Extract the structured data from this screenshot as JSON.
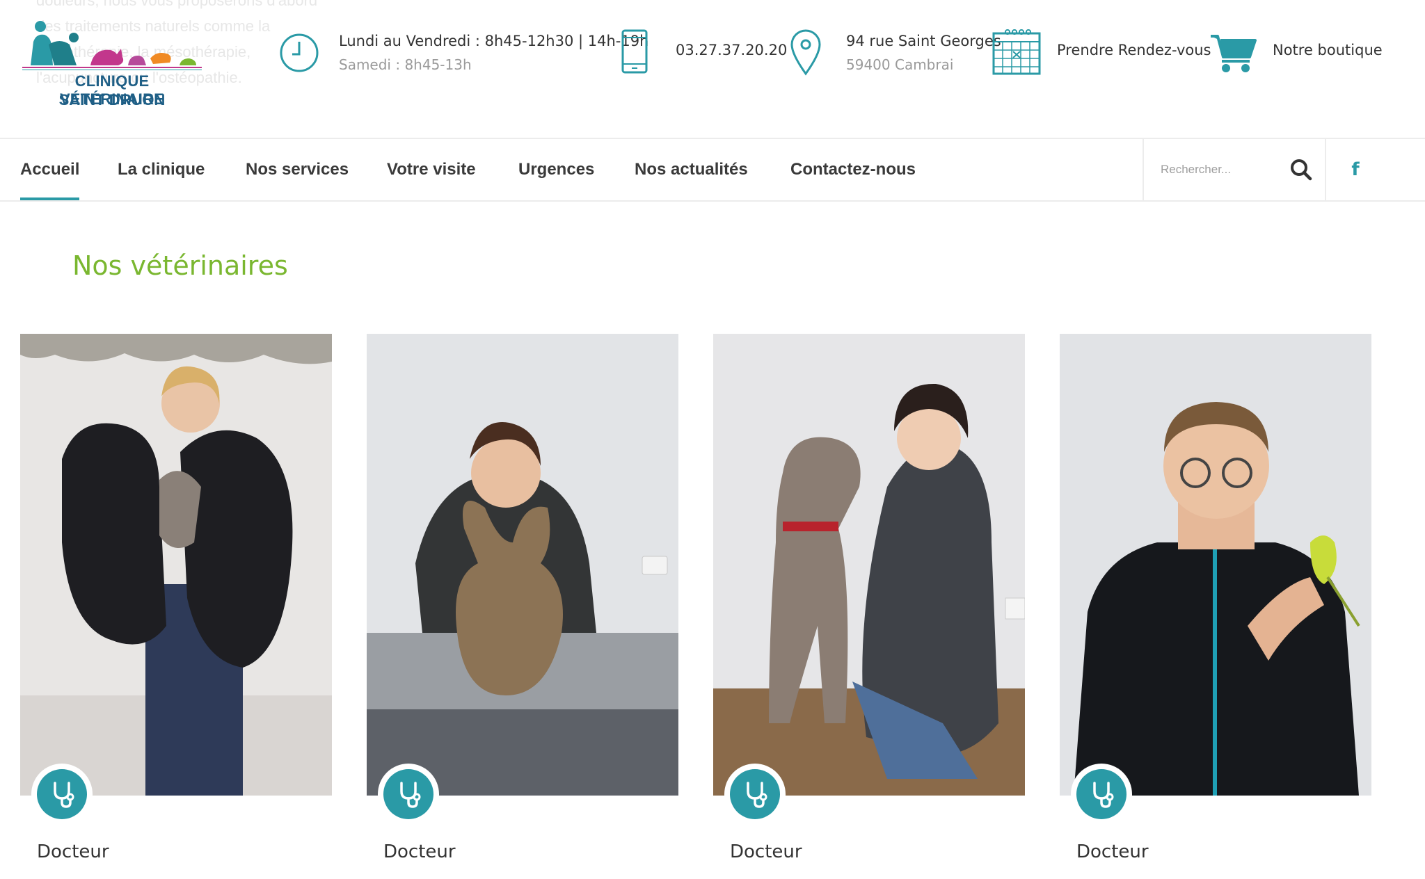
{
  "background_text": [
    "douleurs, nous vous proposerons d'abord",
    "des traitements naturels comme la",
    "phytothérapie, la mésothérapie,",
    "l'acupuncture ou l'ostéopathie."
  ],
  "logo": {
    "line1": "CLINIQUE VÉTÉRINAIRE",
    "line2": "SAINT DRUON"
  },
  "header": {
    "hours": {
      "line1": "Lundi au Vendredi : 8h45-12h30 | 14h-19h",
      "line2": "Samedi : 8h45-13h",
      "icon": "clock-icon"
    },
    "phone": {
      "number": "03.27.37.20.20",
      "icon": "mobile-phone-icon"
    },
    "address": {
      "line1": "94 rue Saint Georges",
      "line2": "59400 Cambrai",
      "icon": "map-pin-icon"
    },
    "appointment": {
      "label": "Prendre Rendez-vous",
      "icon": "calendar-icon"
    },
    "shop": {
      "label": "Notre boutique",
      "icon": "cart-icon"
    }
  },
  "nav": {
    "items": [
      {
        "label": "Accueil",
        "active": true
      },
      {
        "label": "La clinique",
        "active": false
      },
      {
        "label": "Nos services",
        "active": false
      },
      {
        "label": "Votre visite",
        "active": false
      },
      {
        "label": "Urgences",
        "active": false
      },
      {
        "label": "Nos actualités",
        "active": false
      },
      {
        "label": "Contactez-nous",
        "active": false
      }
    ],
    "search_placeholder": "Rechercher...",
    "facebook_label": "f"
  },
  "section": {
    "title": "Nos vétérinaires"
  },
  "vets": [
    {
      "role": "Docteur",
      "photo": "vet-with-newfoundland-puppies",
      "badge_icon": "stethoscope-icon"
    },
    {
      "role": "Docteur",
      "photo": "vet-with-rabbit",
      "badge_icon": "stethoscope-icon"
    },
    {
      "role": "Docteur",
      "photo": "vet-with-weimaraner-dog",
      "badge_icon": "stethoscope-icon"
    },
    {
      "role": "Docteur",
      "photo": "vet-with-budgie",
      "badge_icon": "stethoscope-icon"
    }
  ],
  "colors": {
    "accent": "#2a9aa6",
    "title_green": "#7ab730",
    "logo_blue": "#1f5f86"
  }
}
